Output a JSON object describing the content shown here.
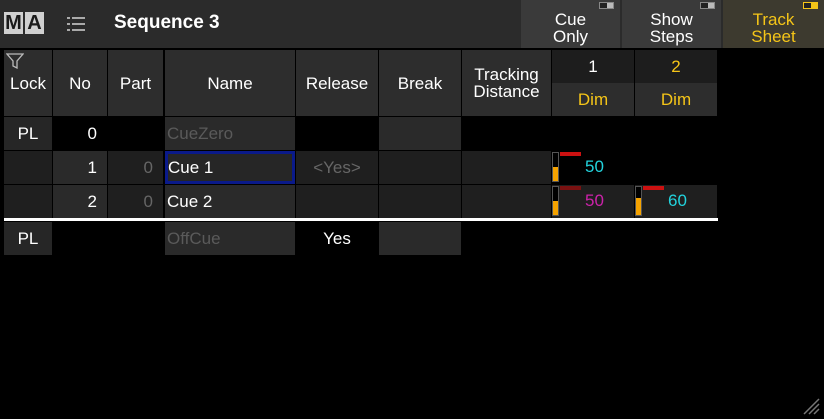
{
  "app": {
    "logo_m": "M",
    "logo_a": "A",
    "title": "Sequence 3"
  },
  "toolbar": [
    {
      "label": "Cue\nOnly",
      "active": false
    },
    {
      "label": "Show\nSteps",
      "active": false
    },
    {
      "label": "Track\nSheet",
      "active": true
    }
  ],
  "columns": {
    "lock": "Lock",
    "no": "No",
    "part": "Part",
    "name": "Name",
    "release": "Release",
    "break": "Break",
    "tracking": "Tracking\nDistance",
    "fixtures": [
      {
        "id": "1",
        "attribute": "Dim"
      },
      {
        "id": "2",
        "attribute": "Dim"
      }
    ]
  },
  "rows": [
    {
      "lock": "PL",
      "no": "0",
      "part": "",
      "name": "CueZero",
      "release": "",
      "break": "",
      "tracking": "",
      "values": []
    },
    {
      "lock": "",
      "no": "1",
      "part": "0",
      "name": "Cue  1",
      "release": "<Yes>",
      "break": "",
      "tracking": "",
      "selected": true,
      "values": [
        {
          "value": "50",
          "color": "#22d3dd",
          "level": 0.5
        }
      ]
    },
    {
      "lock": "",
      "no": "2",
      "part": "0",
      "name": "Cue  2",
      "release": "",
      "break": "",
      "tracking": "",
      "values": [
        {
          "value": "50",
          "color": "#cc22aa",
          "level": 0.5
        },
        {
          "value": "60",
          "color": "#22d3dd",
          "level": 0.6
        }
      ]
    },
    {
      "lock": "PL",
      "no": "",
      "part": "",
      "name": "OffCue",
      "release": "Yes",
      "break": "",
      "tracking": "",
      "values": []
    }
  ],
  "icons": {
    "list": "list-icon",
    "filter": "filter-icon",
    "resize": "resize-grip-icon"
  }
}
